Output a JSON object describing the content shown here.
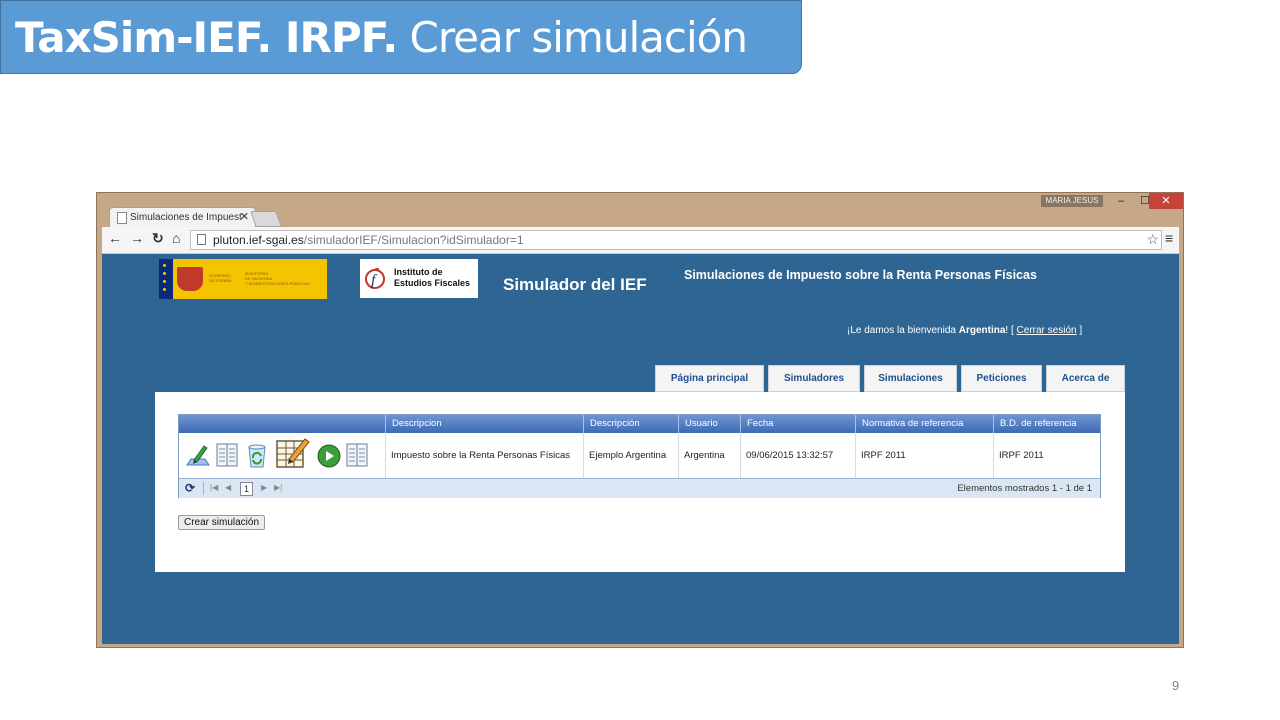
{
  "slide": {
    "title_bold": "TaxSim-IEF. IRPF.",
    "title_rest": "Crear simulación",
    "page_number": "9"
  },
  "browser": {
    "tab_title": "Simulaciones de Impuesto",
    "user_badge": "MARIA JESUS",
    "url_host": "pluton.ief-sgai.es",
    "url_path": "/simuladorIEF/Simulacion?idSimulador=1"
  },
  "site": {
    "ief_logo_line1": "Instituto de",
    "ief_logo_line2": "Estudios Fiscales",
    "simulator_title": "Simulador del IEF",
    "subtitle": "Simulaciones de Impuesto sobre la Renta Personas Físicas",
    "welcome_prefix": "¡Le damos la bienvenida ",
    "welcome_user": "Argentina",
    "welcome_suffix": "! [ ",
    "logout": "Cerrar sesión",
    "welcome_end": " ]"
  },
  "nav": {
    "tabs": [
      "Página principal",
      "Simuladores",
      "Simulaciones",
      "Peticiones",
      "Acerca de"
    ]
  },
  "grid": {
    "columns": [
      "Descripcion",
      "Descripción",
      "Usuario",
      "Fecha",
      "Normativa de referencia",
      "B.D. de referencia"
    ],
    "rows": [
      {
        "descripcion": "Impuesto sobre la Renta Personas Físicas",
        "descripcion2": "Ejemplo Argentina",
        "usuario": "Argentina",
        "fecha": "09/06/2015 13:32:57",
        "normativa": "IRPF 2011",
        "bd": "IRPF 2011",
        "icons": [
          "edit-icon",
          "list-icon",
          "recycle-icon",
          "spreadsheet-edit-icon",
          "play-icon",
          "results-icon"
        ]
      }
    ],
    "pager": {
      "current_page": "1",
      "info": "Elementos mostrados 1 - 1 de 1"
    }
  },
  "actions": {
    "create_label": "Crear simulación"
  },
  "colors": {
    "slide_header": "#5b9bd5",
    "page_bg": "#2e6593",
    "grid_header": "#4a78c0"
  }
}
